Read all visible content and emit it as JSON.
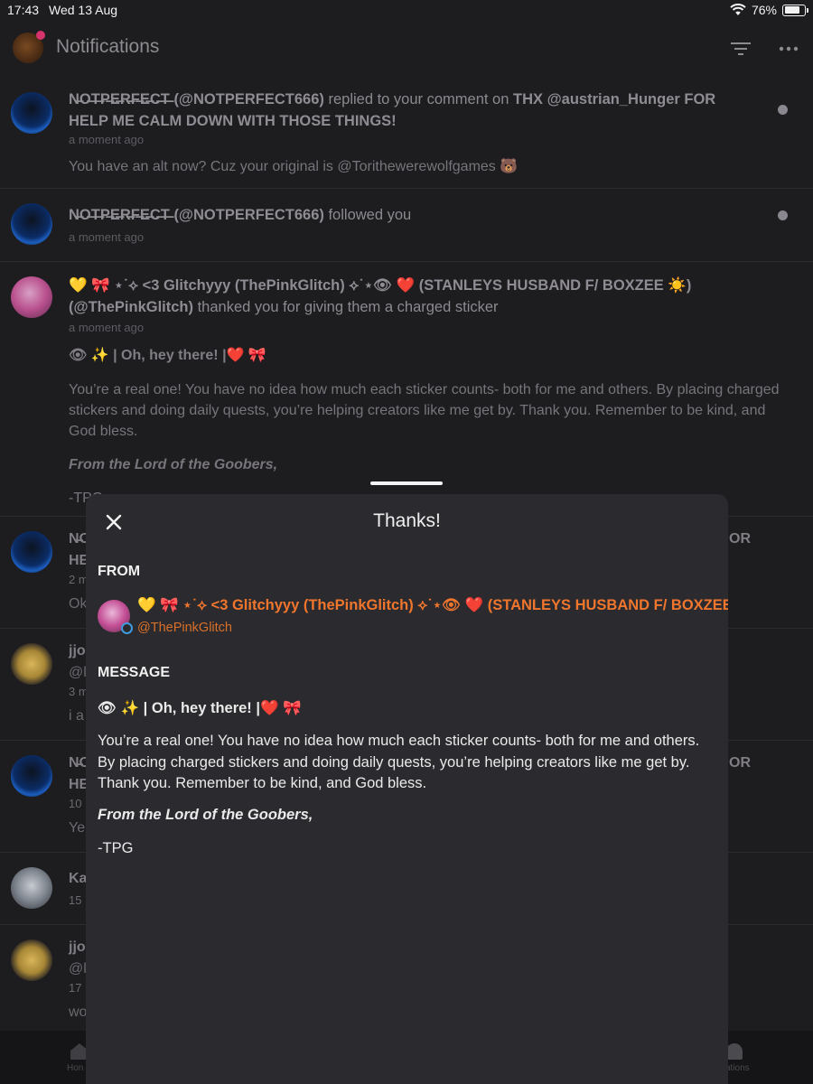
{
  "status_bar": {
    "time": "17:43",
    "date": "Wed 13 Aug",
    "battery": "76%"
  },
  "header": {
    "title": "Notifications"
  },
  "notifications": [
    {
      "name": "N̶O̶T̶P̶E̶R̶F̶E̶C̶T̶",
      "handle": "(@NOTPERFECT666)",
      "action": " replied to your comment on ",
      "target": "THX @austrian_Hunger FOR HELP ME CALM DOWN WITH THOSE THINGS!",
      "time": "a moment ago",
      "body": "You have an alt now? Cuz your original is @Torithewerewolfgames 🐻"
    },
    {
      "name": "N̶O̶T̶P̶E̶R̶F̶E̶C̶T̶",
      "handle": "(@NOTPERFECT666)",
      "action": " followed you",
      "time": "a moment ago"
    },
    {
      "name": "💛 🎀 ⋆˙⟡ <3 Glitchyyy (ThePinkGlitch) ⟡˙⋆👁 ❤️  (STANLEYS HUSBAND F/ BOXZEE ☀️)",
      "handle": "(@ThePinkGlitch)",
      "action": " thanked you for giving them a charged sticker",
      "time": "a moment ago",
      "greeting": "👁 ✨ | Oh, hey there! |❤️ 🎀",
      "body": "You’re a real one! You have no idea how much each sticker counts- both for me and others. By placing charged stickers and doing daily quests, you’re helping creators like me get by. Thank you. Remember to be kind, and God bless.",
      "signoff": "From the Lord of the Goobers,",
      "sign": "-TPG"
    }
  ],
  "background_fragments": {
    "r4_name": "N̶O",
    "r4_line2": "HE",
    "r4_time": "2 m",
    "r4_body": "Ok",
    "r4_right": "OR",
    "r5_name": "jjo",
    "r5_line2": "@l",
    "r5_time": "3 m",
    "r5_body": "i a",
    "r6_name": "N̶O",
    "r6_line2": "HE",
    "r6_time": "10",
    "r6_body": "Ye",
    "r6_right": "OR",
    "r7_name": "Ka",
    "r7_time": "15",
    "r8_name": "jjo",
    "r8_line2": "@l",
    "r8_time": "17",
    "r8_body": "wo"
  },
  "bottom_nav": {
    "home": "Hon",
    "notifications": "cations"
  },
  "sheet": {
    "title": "Thanks!",
    "from_label": "FROM",
    "sender_name": "💛 🎀 ⋆˙⟡ <3 Glitchyyy (ThePinkGlitch) ⟡˙⋆👁 ❤️  (STANLEYS HUSBAND F/ BOXZEE",
    "sender_handle": "@ThePinkGlitch",
    "message_label": "MESSAGE",
    "greeting": "👁 ✨ | Oh, hey there! |❤️ 🎀",
    "body": "You’re a real one! You have no idea how much each sticker counts- both for me and others. By placing charged stickers and doing daily quests, you’re helping creators like me get by. Thank you. Remember to be kind, and God bless.",
    "signoff": "From the Lord of the Goobers,",
    "sign": "-TPG"
  },
  "colors": {
    "accent": "#f0762d",
    "background": "#1d1c1f",
    "sheet": "#2b2a2e"
  }
}
